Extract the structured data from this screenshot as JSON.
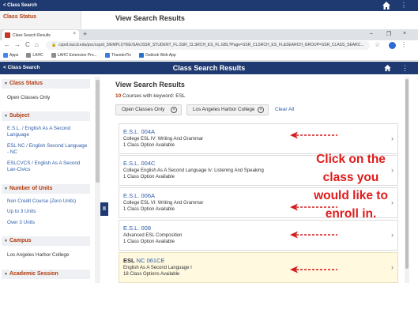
{
  "ghost": {
    "back_label": "< Class Search",
    "title": "Class Search Results",
    "sidebar_status": "Class Status"
  },
  "browser": {
    "tab_title": "Class Search Results",
    "tab_close": "×",
    "new_tab": "+",
    "window_controls": [
      "–",
      "❐",
      "×"
    ],
    "nav": [
      "←",
      "→",
      "C",
      "⌂"
    ],
    "url": "csprd.laccd.edu/psc/csprd_5/EMPLOYEE/SA/c/SSR_STUDENT_FL.SSR_CLSRCH_ES_FL.GBL?Page=SSR_CLSRCH_ES_FL&SEARCH_GROUP=SSR_CLASS_SEARC...",
    "bookmarks": [
      {
        "label": "Apps",
        "color": "#4285f4"
      },
      {
        "label": "LAHC",
        "color": "#8c8c8c"
      },
      {
        "label": "LAHC Extension Pro...",
        "color": "#8c8c8c"
      },
      {
        "label": "ThunderTix",
        "color": "#3b7dd8"
      },
      {
        "label": "Outlook Web App",
        "color": "#2a72c7"
      }
    ]
  },
  "header": {
    "back_label": "< Class Search",
    "title": "Class Search Results"
  },
  "filters": {
    "class_status": {
      "heading": "Class Status",
      "items": [
        "Open Classes Only"
      ]
    },
    "subject": {
      "heading": "Subject",
      "items": [
        "E.S.L. / English As A Second Language",
        "ESL NC / English Second Language - NC",
        "ESLCVCS / English As A Second Lan-Civics"
      ]
    },
    "units": {
      "heading": "Number of Units",
      "items": [
        "Non Credit Course (Zero Units)",
        "Up to 3 Units",
        "Over 3 Units"
      ]
    },
    "campus": {
      "heading": "Campus",
      "items": [
        "Los Angeles Harbor College"
      ]
    },
    "session": {
      "heading": "Academic Session"
    }
  },
  "collapse_label": "II",
  "results": {
    "title": "View Search Results",
    "count": "10",
    "count_suffix": " Courses with keyword: ESL",
    "chips": [
      "Open Classes Only",
      "Los Angeles Harbor College"
    ],
    "clear_all": "Clear All",
    "courses": [
      {
        "code": "E.S.L. 004A",
        "desc": "College ESL IV: Writing And Grammar",
        "avail": "1 Class Option Available"
      },
      {
        "code": "E.S.L. 004C",
        "desc": "College English As A Second Language Iv: Listening And Speaking",
        "avail": "1 Class Option Available"
      },
      {
        "code": "E.S.L. 006A",
        "desc": "College ESL VI: Writing And Grammar",
        "avail": "1 Class Option Available"
      },
      {
        "code": "E.S.L. 008",
        "desc": "Advanced ESL Composition",
        "avail": "1 Class Option Available"
      },
      {
        "code_bold": "ESL",
        "code": " NC 061CE",
        "desc": "English As A Second Language I",
        "avail": "18 Class Options Available"
      }
    ]
  },
  "annotation": {
    "lines": [
      "Click on the",
      "class you",
      "would like to",
      "enroll in."
    ],
    "color": "#e01b1b"
  },
  "colors": {
    "header_bg": "#1f3a70",
    "accent": "#b23b0c",
    "link": "#2e5ca8",
    "highlight_row": "#fff9e0"
  }
}
